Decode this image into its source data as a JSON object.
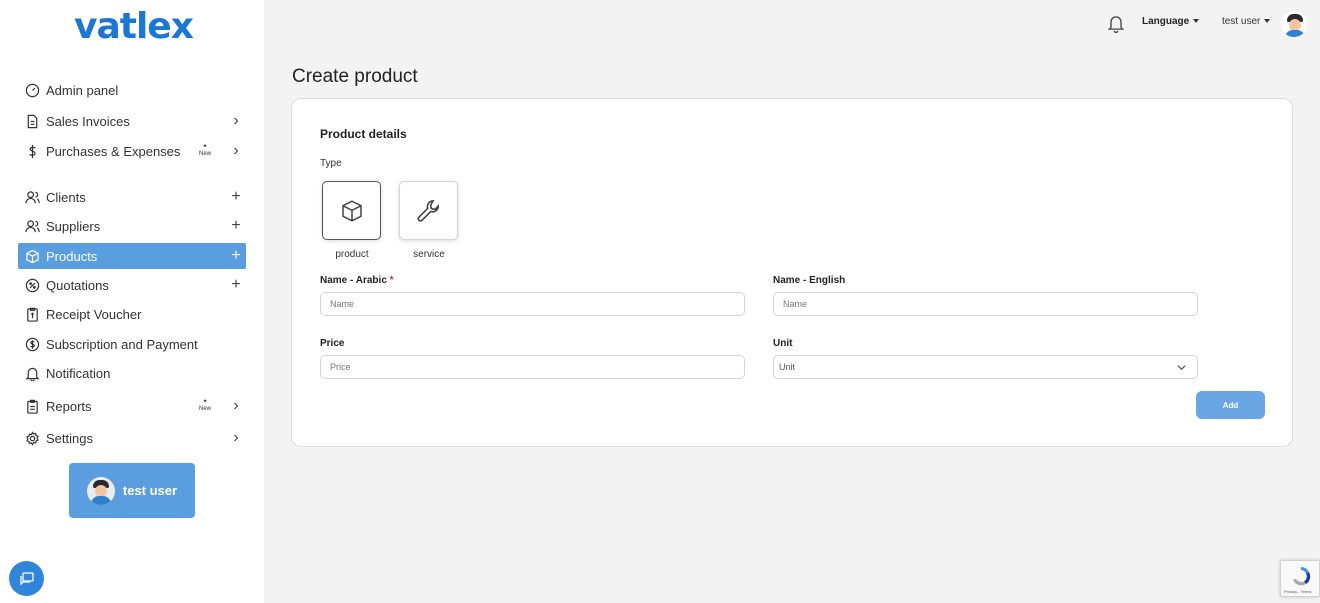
{
  "brand": {
    "logo_text": "vatlex",
    "accent": "#1a78d4",
    "active_bg": "#5b9ee0"
  },
  "sidebar": {
    "items": [
      {
        "label": "Admin panel",
        "icon": "dashboard-icon",
        "trail": ""
      },
      {
        "label": "Sales Invoices",
        "icon": "invoice-icon",
        "trail": "chevron"
      },
      {
        "label": "Purchases & Expenses",
        "icon": "dollar-icon",
        "trail": "chevron",
        "badge": "New"
      },
      {
        "label": "Clients",
        "icon": "users-icon",
        "trail": "plus"
      },
      {
        "label": "Suppliers",
        "icon": "users-icon",
        "trail": "plus"
      },
      {
        "label": "Products",
        "icon": "box-icon",
        "trail": "plus",
        "active": true
      },
      {
        "label": "Quotations",
        "icon": "percent-icon",
        "trail": "plus"
      },
      {
        "label": "Receipt Voucher",
        "icon": "receipt-icon",
        "trail": ""
      },
      {
        "label": "Subscription and Payment",
        "icon": "coin-icon",
        "trail": ""
      },
      {
        "label": "Notification",
        "icon": "bell-icon",
        "trail": ""
      },
      {
        "label": "Reports",
        "icon": "clipboard-icon",
        "trail": "chevron",
        "badge": "New"
      },
      {
        "label": "Settings",
        "icon": "gear-icon",
        "trail": "chevron"
      }
    ],
    "user_card_name": "test user"
  },
  "header": {
    "language_label": "Language",
    "user_label": "test user"
  },
  "main": {
    "title": "Create product",
    "section_title": "Product details",
    "type_label": "Type",
    "types": [
      "product",
      "service"
    ],
    "selected_type": "product",
    "fields": {
      "name_ar_label": "Name - Arabic",
      "name_ar_required": "*",
      "name_ar_placeholder": "Name",
      "name_en_label": "Name - English",
      "name_en_placeholder": "Name",
      "price_label": "Price",
      "price_placeholder": "Price",
      "unit_label": "Unit",
      "unit_value": "Unit"
    },
    "add_label": "Add"
  },
  "recaptcha": {
    "text": "Privacy - Terms"
  }
}
